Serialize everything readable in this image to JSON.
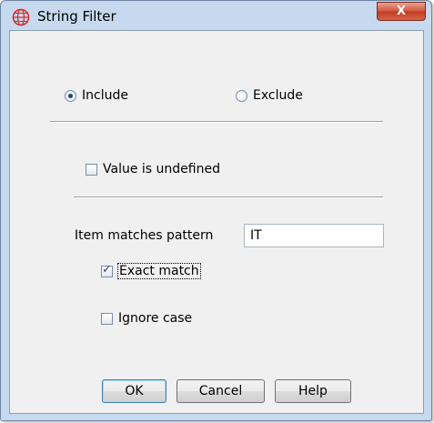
{
  "window": {
    "title": "String Filter",
    "close_label": "X"
  },
  "mode": {
    "include_label": "Include",
    "exclude_label": "Exclude",
    "selected": "Include"
  },
  "undefined_option": {
    "label": "Value is undefined",
    "checked": false
  },
  "pattern": {
    "label": "Item matches pattern",
    "value": "IT"
  },
  "exact_match": {
    "label": "Exact match",
    "checked": true
  },
  "ignore_case": {
    "label": "Ignore case",
    "checked": false
  },
  "buttons": {
    "ok": "OK",
    "cancel": "Cancel",
    "help": "Help"
  },
  "colors": {
    "frame": "#c7d9ee",
    "client": "#f0f0f0",
    "close_button": "#c23a22",
    "app_icon": "#d32f2f"
  }
}
